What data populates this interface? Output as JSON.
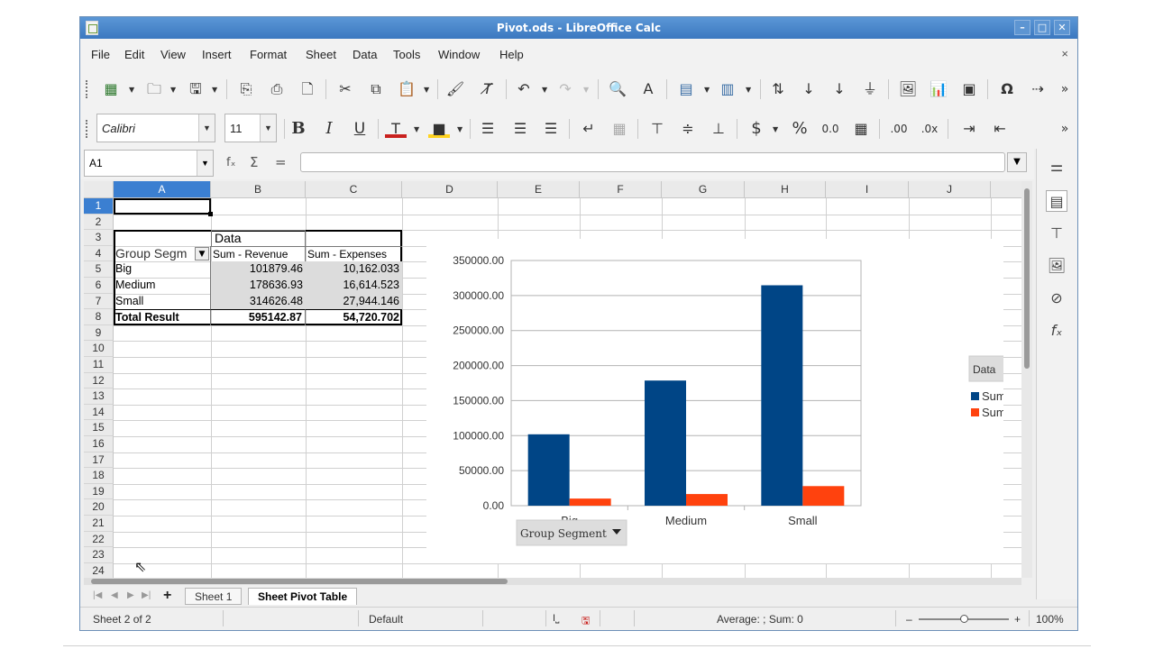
{
  "window": {
    "title": "Pivot.ods - LibreOffice Calc",
    "controls": {
      "minimize": "–",
      "maximize": "□",
      "close": "✕"
    }
  },
  "menu": {
    "items": [
      "File",
      "Edit",
      "View",
      "Insert",
      "Format",
      "Sheet",
      "Data",
      "Tools",
      "Window",
      "Help"
    ],
    "close_doc": "×"
  },
  "toolbar_formatting": {
    "font_name": "Calibri",
    "font_size": "11"
  },
  "formula_bar": {
    "name_box": "A1",
    "fx": "fₓ",
    "sum": "Σ",
    "equals": "=",
    "value": ""
  },
  "grid": {
    "columns": [
      "A",
      "B",
      "C",
      "D",
      "E",
      "F",
      "G",
      "H",
      "I",
      "J"
    ],
    "selected_column": "A",
    "rows": [
      "1",
      "2",
      "3",
      "4",
      "5",
      "6",
      "7",
      "8",
      "9",
      "10",
      "11",
      "12",
      "13",
      "14",
      "15",
      "16",
      "17",
      "18",
      "19",
      "20",
      "21",
      "22",
      "23",
      "24"
    ],
    "selected_row": "1"
  },
  "pivot": {
    "data_label": "Data",
    "row_field": "Group Segm",
    "col_headers": [
      "Sum - Revenue",
      "Sum - Expenses"
    ],
    "rows": [
      {
        "label": "Big",
        "revenue": "101879.46",
        "expenses": "10,162.033"
      },
      {
        "label": "Medium",
        "revenue": "178636.93",
        "expenses": "16,614.523"
      },
      {
        "label": "Small",
        "revenue": "314626.48",
        "expenses": "27,944.146"
      }
    ],
    "total": {
      "label": "Total Result",
      "revenue": "595142.87",
      "expenses": "54,720.702"
    }
  },
  "chart_data": {
    "type": "bar",
    "categories": [
      "Big",
      "Medium",
      "Small"
    ],
    "series": [
      {
        "name": "Sum - Revenue",
        "values": [
          101879.46,
          178636.93,
          314626.48
        ],
        "color": "#004586"
      },
      {
        "name": "Sum - Expenses",
        "values": [
          10162.033,
          16614.523,
          27944.146
        ],
        "color": "#ff420e"
      }
    ],
    "ylim": [
      0,
      350000
    ],
    "yticks": [
      "0.00",
      "50000.00",
      "100000.00",
      "150000.00",
      "200000.00",
      "250000.00",
      "300000.00",
      "350000.00"
    ],
    "legend_title": "Data",
    "legend_position": "right",
    "field_button": "Group Segment",
    "grid": true
  },
  "sheet_tabs": {
    "add": "+",
    "tabs": [
      "Sheet 1",
      "Sheet Pivot Table"
    ],
    "active": "Sheet Pivot Table"
  },
  "status": {
    "sheet": "Sheet 2 of 2",
    "style": "Default",
    "summary": "Average: ; Sum: 0",
    "zoom": "100%",
    "zoom_minus": "–",
    "zoom_plus": "+"
  }
}
